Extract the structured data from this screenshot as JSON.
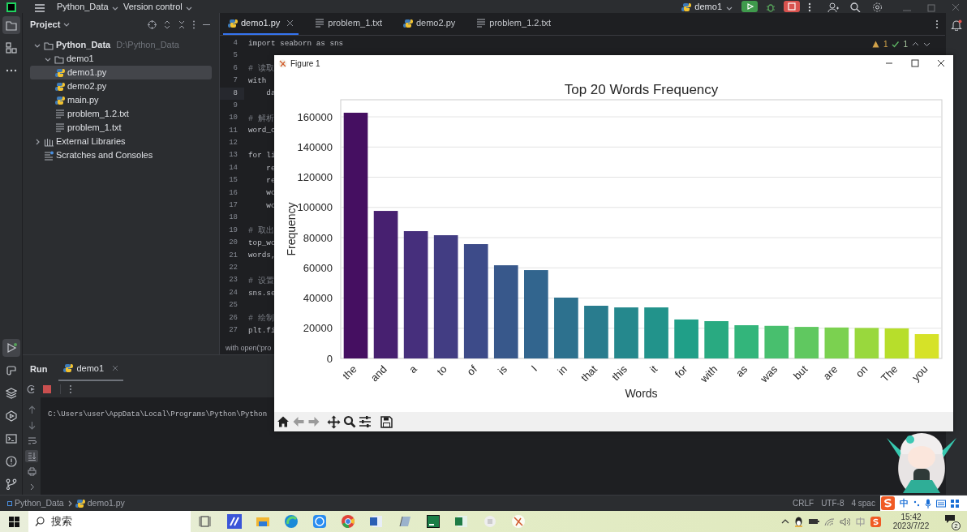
{
  "title_bar": {
    "project": "Python_Data",
    "vcs": "Version control",
    "run_config": "demo1"
  },
  "project_panel": {
    "title": "Project",
    "tree": [
      {
        "label": "Python_Data",
        "path": "D:\\Python_Data",
        "kind": "folder",
        "expanded": true,
        "selected": false,
        "children": [
          {
            "label": "demo1",
            "kind": "folder",
            "expanded": true,
            "selected": false,
            "children": [
              {
                "label": "demo1.py",
                "kind": "python",
                "selected": true
              },
              {
                "label": "demo2.py",
                "kind": "python",
                "selected": false
              },
              {
                "label": "main.py",
                "kind": "python",
                "selected": false
              },
              {
                "label": "problem_1.2.txt",
                "kind": "text",
                "selected": false
              },
              {
                "label": "problem_1.txt",
                "kind": "text",
                "selected": false
              }
            ]
          }
        ]
      },
      {
        "label": "External Libraries",
        "kind": "library",
        "expanded": false,
        "selected": false
      },
      {
        "label": "Scratches and Consoles",
        "kind": "scratches",
        "selected": false
      }
    ]
  },
  "editor": {
    "tabs": [
      {
        "label": "demo1.py",
        "kind": "python",
        "selected": true
      },
      {
        "label": "problem_1.txt",
        "kind": "text",
        "selected": false
      },
      {
        "label": "demo2.py",
        "kind": "python",
        "selected": false
      },
      {
        "label": "problem_1.2.txt",
        "kind": "text",
        "selected": false
      }
    ],
    "inspections": {
      "warnings": "1",
      "weak_warnings": "1"
    },
    "lines": [
      {
        "number": "4",
        "kind": "code",
        "text": "import seaborn as sns",
        "current": false
      },
      {
        "number": "5",
        "current": false
      },
      {
        "number": "6",
        "kind": "comment",
        "text": "# 读取",
        "current": false
      },
      {
        "number": "7",
        "kind": "code",
        "text": "with",
        "current": false
      },
      {
        "number": "8",
        "kind": "code",
        "text": "    da",
        "current": true
      },
      {
        "number": "9",
        "current": false
      },
      {
        "number": "10",
        "kind": "comment",
        "text": "# 解析",
        "current": false
      },
      {
        "number": "11",
        "kind": "code",
        "text": "word_c",
        "current": false
      },
      {
        "number": "12",
        "current": false
      },
      {
        "number": "13",
        "kind": "code",
        "text": "for li",
        "current": false
      },
      {
        "number": "14",
        "kind": "code",
        "text": "    re",
        "current": false
      },
      {
        "number": "15",
        "kind": "code",
        "text": "    re",
        "current": false
      },
      {
        "number": "16",
        "kind": "code",
        "text": "    wo",
        "current": false
      },
      {
        "number": "17",
        "kind": "code",
        "text": "    wo",
        "current": false
      },
      {
        "number": "18",
        "current": false
      },
      {
        "number": "19",
        "kind": "comment",
        "text": "# 取出",
        "current": false
      },
      {
        "number": "20",
        "kind": "code",
        "text": "top_wo",
        "current": false
      },
      {
        "number": "21",
        "kind": "code",
        "text": "words,",
        "current": false
      },
      {
        "number": "22",
        "current": false
      },
      {
        "number": "23",
        "kind": "comment",
        "text": "# 设置",
        "current": false
      },
      {
        "number": "24",
        "kind": "code",
        "text": "sns.se",
        "current": false
      },
      {
        "number": "25",
        "current": false
      },
      {
        "number": "26",
        "kind": "comment",
        "text": "# 绘制",
        "current": false
      },
      {
        "number": "27",
        "kind": "code",
        "text": "plt.fi",
        "current": false
      }
    ],
    "breadcrumb": "with open('pro"
  },
  "figure": {
    "title": "Figure 1",
    "chart_data": {
      "type": "bar",
      "title": "Top 20 Words Frequency",
      "xlabel": "Words",
      "ylabel": "Frequency",
      "categories": [
        "the",
        "and",
        "a",
        "to",
        "of",
        "is",
        "I",
        "in",
        "that",
        "this",
        "it",
        "for",
        "with",
        "as",
        "was",
        "but",
        "are",
        "on",
        "The",
        "you"
      ],
      "grid": true,
      "series": [
        {
          "values": [
            162700,
            97700,
            84300,
            81600,
            75700,
            61700,
            58500,
            40300,
            34900,
            33800,
            33800,
            25800,
            24700,
            22000,
            21600,
            20900,
            20500,
            20200,
            19900,
            16100
          ]
        }
      ],
      "ylim": [
        0,
        171300
      ],
      "yticks": [
        0,
        20000,
        40000,
        60000,
        80000,
        100000,
        120000,
        140000,
        160000
      ]
    }
  },
  "run_panel": {
    "title": "Run",
    "tabs": [
      {
        "label": "demo1",
        "selected": true
      }
    ],
    "output": "C:\\Users\\user\\AppData\\Local\\Programs\\Python\\Python"
  },
  "status_bar": {
    "path": [
      "Python_Data",
      "demo1.py"
    ],
    "items": [
      "CRLF",
      "UTF-8",
      "4 spac"
    ]
  },
  "ime_bar": {
    "mode": "中"
  },
  "taskbar": {
    "search_placeholder": "搜索",
    "time": "15:42",
    "date": "2023/7/22",
    "notifications": "2"
  }
}
